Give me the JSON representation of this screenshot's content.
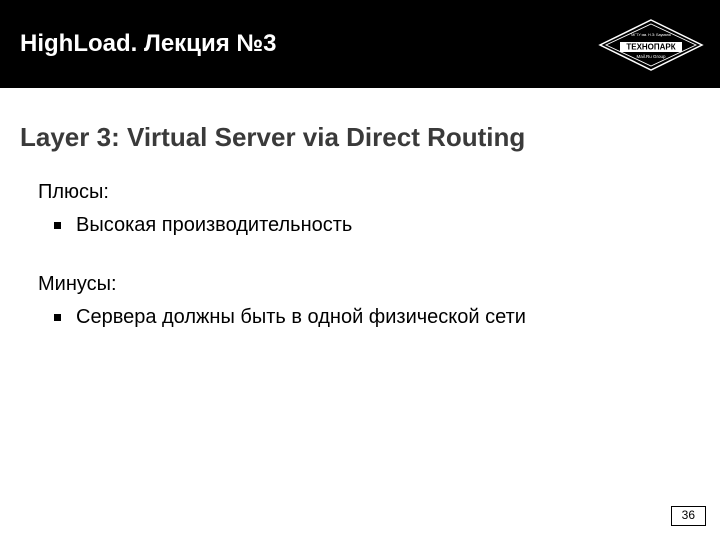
{
  "header": {
    "title": "HighLoad. Лекция №3",
    "logo_top": "ТЕХНОПАРК",
    "logo_sub": "Mail.Ru Group"
  },
  "slide_title": "Layer 3: Virtual Server via Direct Routing",
  "pros": {
    "label": "Плюсы:",
    "items": [
      "Высокая производительность"
    ]
  },
  "cons": {
    "label": "Минусы:",
    "items": [
      "Сервера должны быть в одной физической сети"
    ]
  },
  "page_number": "36"
}
